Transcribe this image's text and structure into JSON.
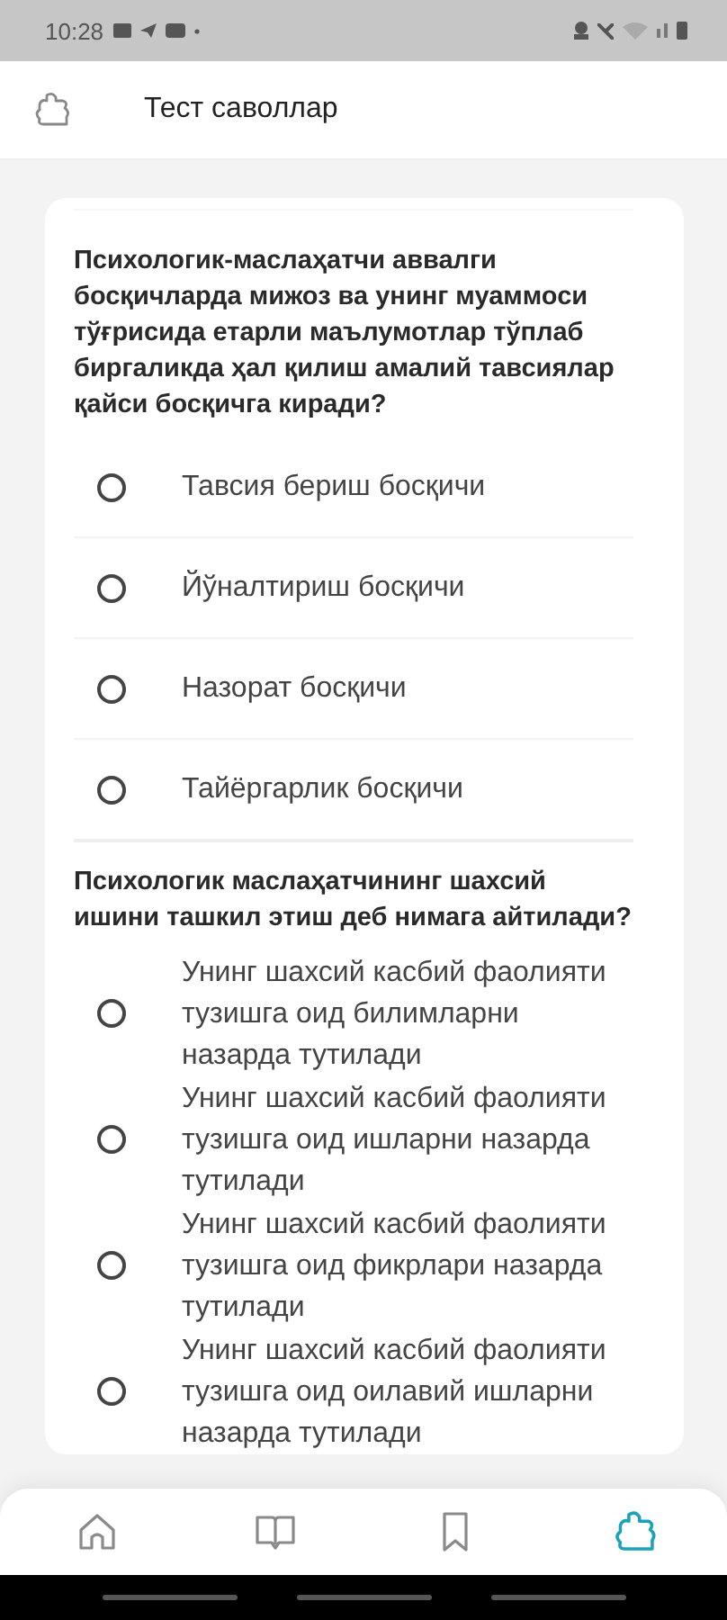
{
  "status_bar": {
    "time": "10:28"
  },
  "header": {
    "title": "Тест саволлар"
  },
  "questions": [
    {
      "text": "Психологик-маслаҳатчи аввалги босқичларда мижоз ва унинг муаммоси тўғрисида етарли маълумотлар тўплаб биргаликда ҳал қилиш амалий тавсиялар қайси босқичга киради?",
      "options": [
        {
          "label": "Тавсия бериш босқичи",
          "selected": false
        },
        {
          "label": "Йўналтириш босқичи",
          "selected": false
        },
        {
          "label": "Назорат босқичи",
          "selected": false
        },
        {
          "label": "Тайёргарлик босқичи",
          "selected": false
        }
      ]
    },
    {
      "text": "Психологик маслаҳатчининг шахсий ишини ташкил этиш деб нимага айтилади?",
      "options": [
        {
          "label": "Унинг шахсий касбий фаолияти тузишга оид билимларни назарда тутилади",
          "selected": false
        },
        {
          "label": "Унинг шахсий касбий фаолияти тузишга оид ишларни назарда тутилади",
          "selected": false
        },
        {
          "label": "Унинг шахсий касбий фаолияти тузишга оид фикрлари назарда тутилади",
          "selected": false
        },
        {
          "label": "Унинг шахсий касбий фаолияти тузишга оид оилавий ишларни назарда тутилади",
          "selected": false
        }
      ]
    }
  ],
  "nav": [
    {
      "kind": "home",
      "selected": false
    },
    {
      "kind": "book",
      "selected": false
    },
    {
      "kind": "bookmark",
      "selected": false
    },
    {
      "kind": "puzzle",
      "selected": true
    }
  ]
}
